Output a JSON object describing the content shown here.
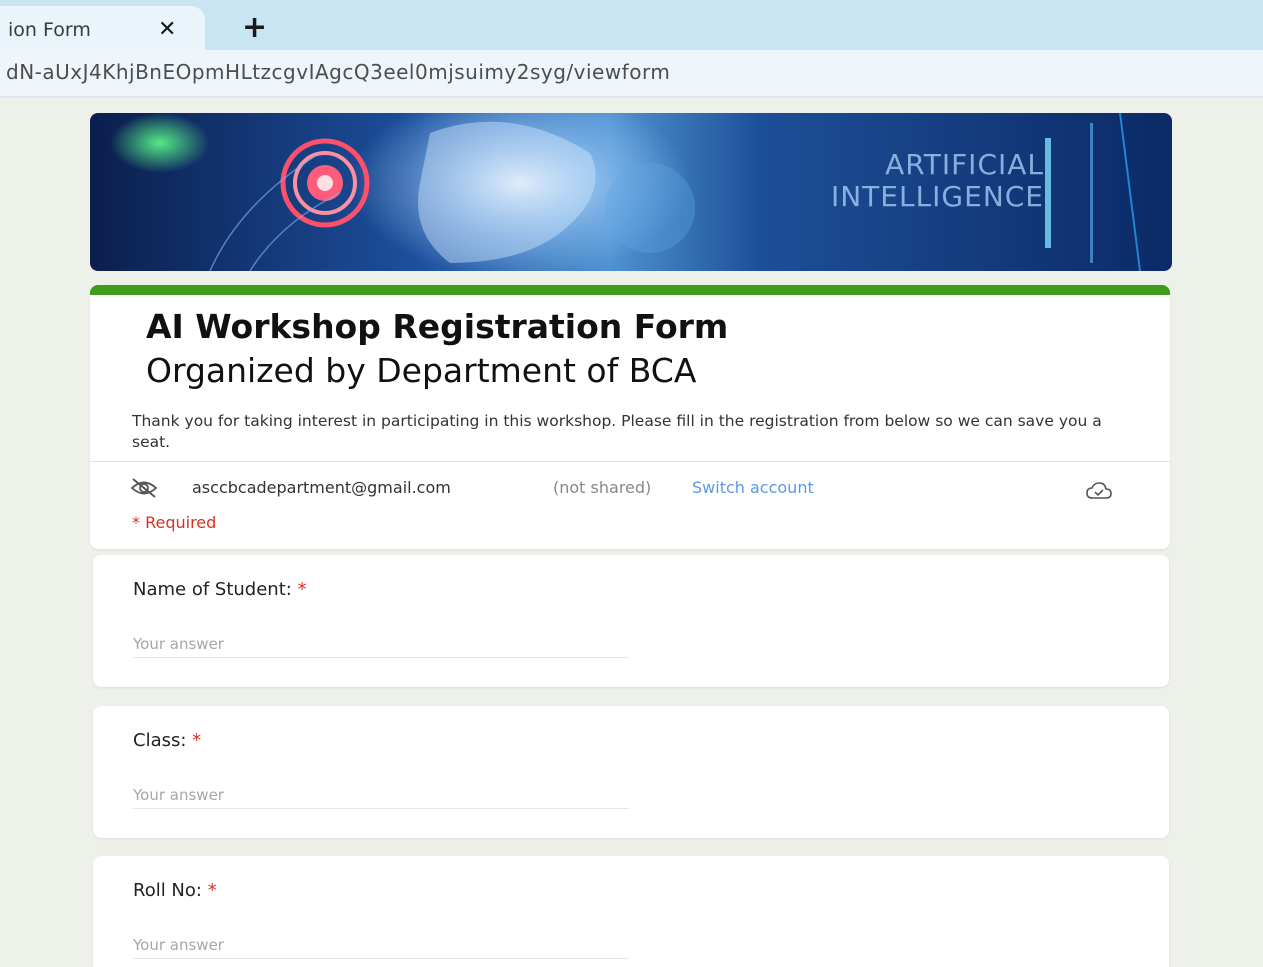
{
  "browser": {
    "tab_title": "ion Form",
    "tab_close_glyph": "✕",
    "new_tab_glyph": "+",
    "url": "dN-aUxJ4KhjBnEOpmHLtzcgvIAgcQ3eel0mjsuimy2syg/viewform"
  },
  "banner": {
    "line1": "ARTIFICIAL",
    "line2": "INTELLIGENCE"
  },
  "form": {
    "title": "AI Workshop Registration Form",
    "subtitle": "Organized by Department of BCA",
    "description": "Thank you for taking interest in participating in this workshop. Please fill in the registration from below so we can save you a seat.",
    "account_email": "asccbcadepartment@gmail.com",
    "not_shared": "(not shared)",
    "switch_account": "Switch account",
    "required_note": "* Required"
  },
  "questions": [
    {
      "label": "Name of Student:",
      "asterisk": "*",
      "placeholder": "Your answer"
    },
    {
      "label": "Class:",
      "asterisk": "*",
      "placeholder": "Your answer"
    },
    {
      "label": "Roll No:",
      "asterisk": "*",
      "placeholder": "Your answer"
    }
  ],
  "colors": {
    "header_accent": "#3d9b1e",
    "required_red": "#d93025",
    "link_blue": "#5a9ae6",
    "page_background": "#eef0ea"
  },
  "icons": {
    "account_privacy": "eye-off-icon",
    "save_status": "cloud-icon"
  }
}
